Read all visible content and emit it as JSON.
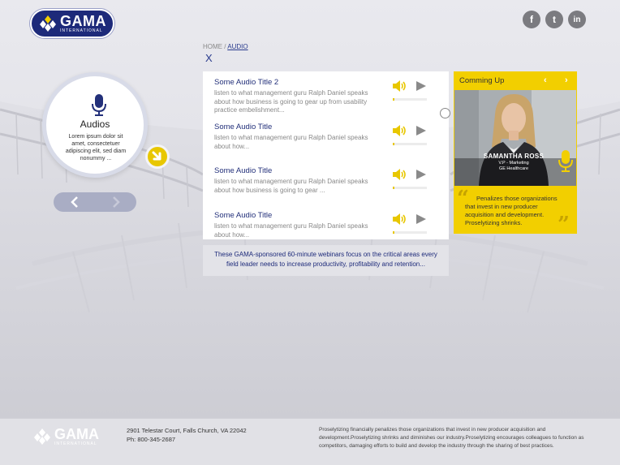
{
  "logo": {
    "word": "GAMA",
    "sub": "INTERNATIONAL"
  },
  "social": [
    {
      "icon": "facebook-icon",
      "glyph": "f"
    },
    {
      "icon": "twitter-icon",
      "glyph": "t"
    },
    {
      "icon": "linkedin-icon",
      "glyph": "in"
    }
  ],
  "breadcrumb": {
    "home": "HOME",
    "separator": " / ",
    "current": "AUDIO"
  },
  "close_label": "X",
  "bubble": {
    "title": "Audios",
    "text": "Lorem ipsum dolor sit amet, consectetuer adipiscing elit, sed diam nonummy ..."
  },
  "audio_items": [
    {
      "title": "Some Audio Title 2",
      "desc": "listen to what management guru Ralph Daniel speaks about how business is going to gear up from usability practice embelishment...",
      "progress": 0.05
    },
    {
      "title": "Some Audio Title",
      "desc": "listen to what management guru Ralph Daniel speaks about how...",
      "progress": 0.05
    },
    {
      "title": "Some Audio Title",
      "desc": "listen to what management guru Ralph Daniel speaks about how business is going to gear ...",
      "progress": 0.05
    },
    {
      "title": "Some Audio Title",
      "desc": "listen to what management guru Ralph Daniel speaks about how...",
      "progress": 0.05
    }
  ],
  "info_text": "These GAMA-sponsored 60-minute webinars focus on the critical areas every field leader needs to increase productivity, profitability and retention...",
  "upcoming": {
    "title": "Comming Up",
    "prev": "‹",
    "next": "›",
    "name": "SAMANTHA ROSS",
    "role_line1": "V.P - Marketing",
    "role_line2": "GE Healthcare",
    "quote": "Penalizes those organizations that invest in new producer acquisition and development. Proselytizing shrinks."
  },
  "footer": {
    "logo_word": "GAMA",
    "logo_sub": "INTERNATIONAL",
    "address": "2901 Telestar Court, Falls Church, VA 22042",
    "phone": "Ph: 800-345-2687",
    "text": "Proselytizing financially penalizes those organizations that invest in new producer acquisition and development.Proselytizing shrinks and diminishes our industry.Proselytizing encourages colleagues to function as competitors, damaging efforts to build and develop the industry through the sharing of best practices."
  },
  "colors": {
    "brand_blue": "#1d2a7a",
    "accent_yellow": "#f2cf00",
    "background": "#e4e4ea"
  }
}
